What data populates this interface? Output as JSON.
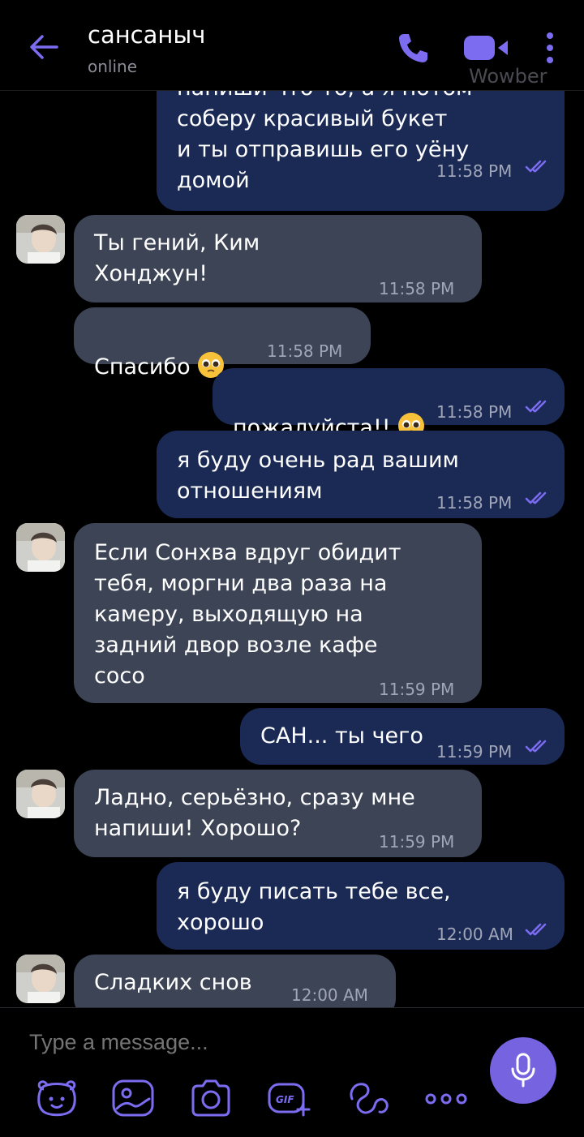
{
  "header": {
    "title": "сансаныч",
    "status": "online",
    "watermark": "Wowber"
  },
  "messages": [
    {
      "side": "out",
      "text": "напиши что-то, а я потом\nсоберу красивый букет\nи ты отправишь его уёну\nдомой",
      "time": "11:58 PM",
      "read": true
    },
    {
      "side": "in",
      "text": "Ты гений, Ким\nХонджун!",
      "time": "11:58 PM",
      "avatar": true
    },
    {
      "side": "in",
      "text": "Спасибо",
      "emoji": "pleading-face",
      "time": "11:58 PM"
    },
    {
      "side": "out",
      "text": "пожалуйста!!",
      "emoji": "pleading-face",
      "time": "11:58 PM",
      "read": true
    },
    {
      "side": "out",
      "text": "я буду очень рад вашим\nотношениям",
      "time": "11:58 PM",
      "read": true
    },
    {
      "side": "in",
      "text": "Если Сонхва вдруг обидит\nтебя, моргни два раза на\nкамеру, выходящую на\nзадний двор возле кафе\nсосо",
      "time": "11:59 PM",
      "avatar": true
    },
    {
      "side": "out",
      "text": "САН... ты чего",
      "time": "11:59 PM",
      "read": true
    },
    {
      "side": "in",
      "text": "Ладно, серьёзно, сразу мне\nнапиши! Хорошо?",
      "time": "11:59 PM",
      "avatar": true
    },
    {
      "side": "out",
      "text": "я буду писать тебе все,\nхорошо",
      "time": "12:00 AM",
      "read": true
    },
    {
      "side": "in",
      "text": "Сладких снов",
      "time": "12:00 AM",
      "avatar": true
    }
  ],
  "composer": {
    "placeholder": "Type a message...",
    "tools": [
      "sticker-bear-icon",
      "doodle-icon",
      "camera-icon",
      "gif-icon",
      "emoticon-icon",
      "more-options-icon"
    ]
  },
  "colors": {
    "background": "#000000",
    "outgoing_bubble": "#1a2a55",
    "incoming_bubble": "#3c4455",
    "accent": "#7563e0",
    "read_ticks": "#7b6cf0"
  }
}
